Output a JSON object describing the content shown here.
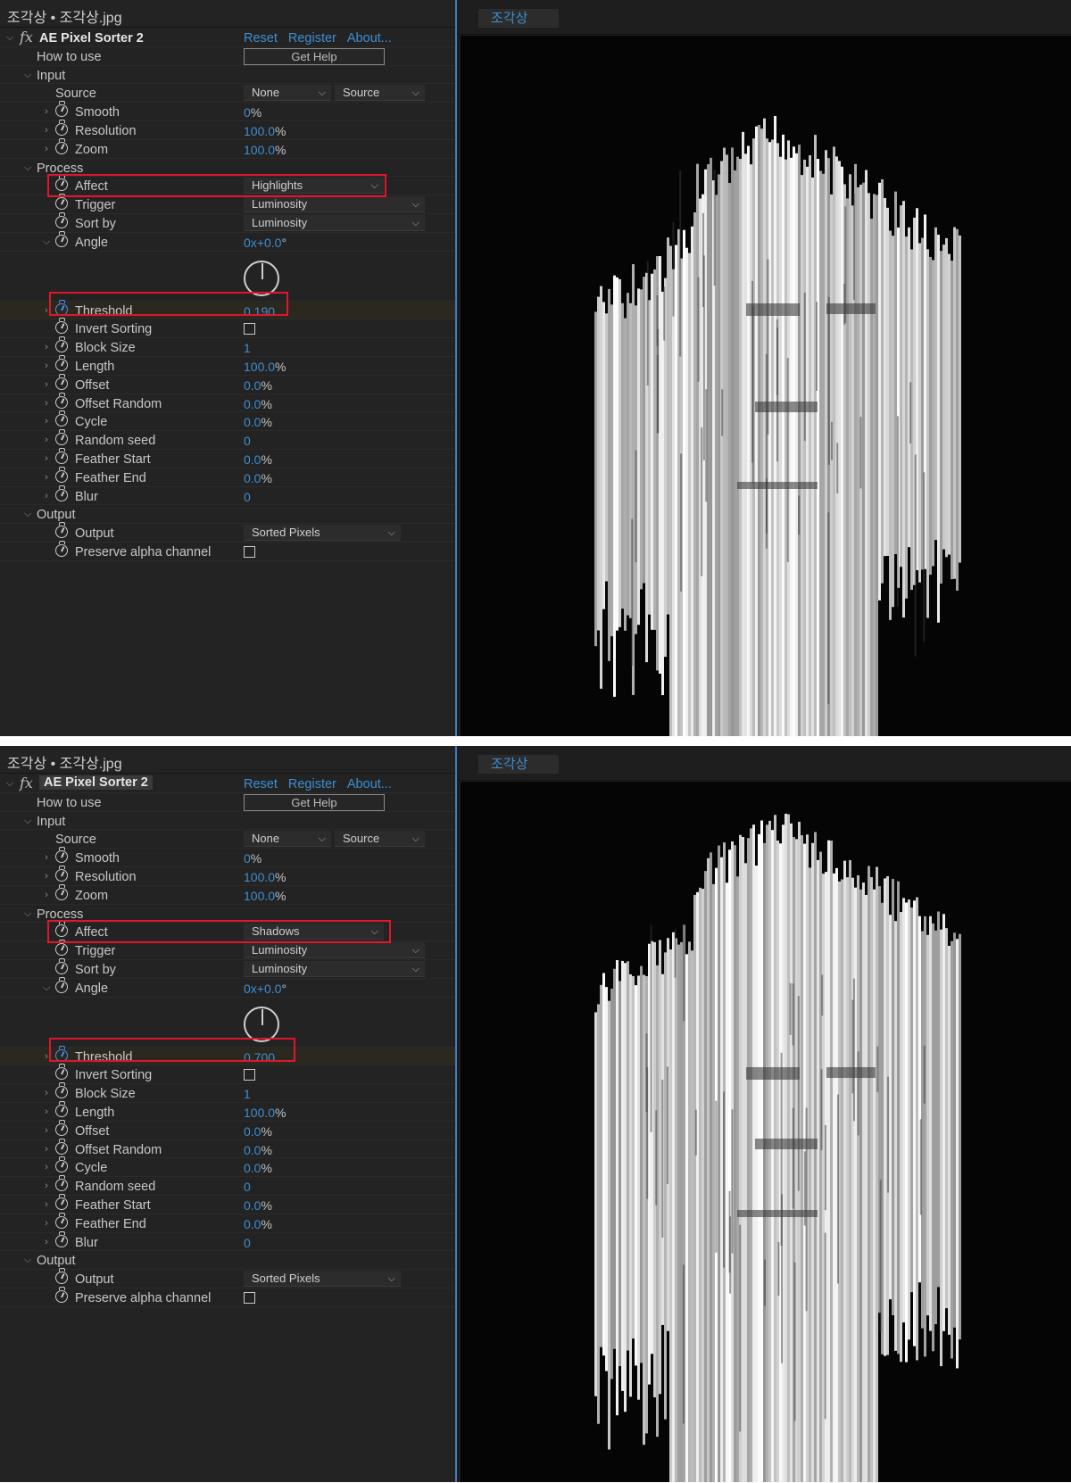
{
  "panels": [
    {
      "title": "조각상 • 조각상.jpg",
      "effect_name": "AE Pixel Sorter 2",
      "links": [
        "Reset",
        "Register",
        "About..."
      ],
      "how_to_use": {
        "label": "How to use",
        "button": "Get Help"
      },
      "groups": {
        "input": "Input",
        "process": "Process",
        "output": "Output"
      },
      "source": {
        "label": "Source",
        "dropdown1": "None",
        "dropdown2": "Source"
      },
      "smooth": {
        "label": "Smooth",
        "value": "0",
        "unit": "%"
      },
      "resolution": {
        "label": "Resolution",
        "value": "100.0",
        "unit": "%"
      },
      "zoom": {
        "label": "Zoom",
        "value": "100.0",
        "unit": "%"
      },
      "affect": {
        "label": "Affect",
        "value": "Highlights"
      },
      "trigger": {
        "label": "Trigger",
        "value": "Luminosity"
      },
      "sort_by": {
        "label": "Sort by",
        "value": "Luminosity"
      },
      "angle": {
        "label": "Angle",
        "value": "0x+0.0",
        "unit": "°"
      },
      "threshold": {
        "label": "Threshold",
        "value": "0.190"
      },
      "invert_sorting": {
        "label": "Invert Sorting",
        "checked": false
      },
      "block_size": {
        "label": "Block Size",
        "value": "1"
      },
      "length": {
        "label": "Length",
        "value": "100.0",
        "unit": "%"
      },
      "offset": {
        "label": "Offset",
        "value": "0.0",
        "unit": "%"
      },
      "offset_random": {
        "label": "Offset Random",
        "value": "0.0",
        "unit": "%"
      },
      "cycle": {
        "label": "Cycle",
        "value": "0.0",
        "unit": "%"
      },
      "random_seed": {
        "label": "Random seed",
        "value": "0"
      },
      "feather_start": {
        "label": "Feather Start",
        "value": "0.0",
        "unit": "%"
      },
      "feather_end": {
        "label": "Feather End",
        "value": "0.0",
        "unit": "%"
      },
      "blur": {
        "label": "Blur",
        "value": "0"
      },
      "output": {
        "label": "Output",
        "value": "Sorted Pixels"
      },
      "preserve_alpha": {
        "label": "Preserve alpha channel",
        "checked": false
      },
      "preview_tab": "조각상"
    },
    {
      "title": "조각상 • 조각상.jpg",
      "effect_name": "AE Pixel Sorter 2",
      "links": [
        "Reset",
        "Register",
        "About..."
      ],
      "how_to_use": {
        "label": "How to use",
        "button": "Get Help"
      },
      "groups": {
        "input": "Input",
        "process": "Process",
        "output": "Output"
      },
      "source": {
        "label": "Source",
        "dropdown1": "None",
        "dropdown2": "Source"
      },
      "smooth": {
        "label": "Smooth",
        "value": "0",
        "unit": "%"
      },
      "resolution": {
        "label": "Resolution",
        "value": "100.0",
        "unit": "%"
      },
      "zoom": {
        "label": "Zoom",
        "value": "100.0",
        "unit": "%"
      },
      "affect": {
        "label": "Affect",
        "value": "Shadows"
      },
      "trigger": {
        "label": "Trigger",
        "value": "Luminosity"
      },
      "sort_by": {
        "label": "Sort by",
        "value": "Luminosity"
      },
      "angle": {
        "label": "Angle",
        "value": "0x+0.0",
        "unit": "°"
      },
      "threshold": {
        "label": "Threshold",
        "value": "0.700"
      },
      "invert_sorting": {
        "label": "Invert Sorting",
        "checked": false
      },
      "block_size": {
        "label": "Block Size",
        "value": "1"
      },
      "length": {
        "label": "Length",
        "value": "100.0",
        "unit": "%"
      },
      "offset": {
        "label": "Offset",
        "value": "0.0",
        "unit": "%"
      },
      "offset_random": {
        "label": "Offset Random",
        "value": "0.0",
        "unit": "%"
      },
      "cycle": {
        "label": "Cycle",
        "value": "0.0",
        "unit": "%"
      },
      "random_seed": {
        "label": "Random seed",
        "value": "0"
      },
      "feather_start": {
        "label": "Feather Start",
        "value": "0.0",
        "unit": "%"
      },
      "feather_end": {
        "label": "Feather End",
        "value": "0.0",
        "unit": "%"
      },
      "blur": {
        "label": "Blur",
        "value": "0"
      },
      "output": {
        "label": "Output",
        "value": "Sorted Pixels"
      },
      "preserve_alpha": {
        "label": "Preserve alpha channel",
        "checked": false
      },
      "preview_tab": "조각상"
    }
  ],
  "colors": {
    "highlight_box": "#e0162b",
    "value_blue": "#3e8ed0",
    "panel_bg": "#232323"
  }
}
